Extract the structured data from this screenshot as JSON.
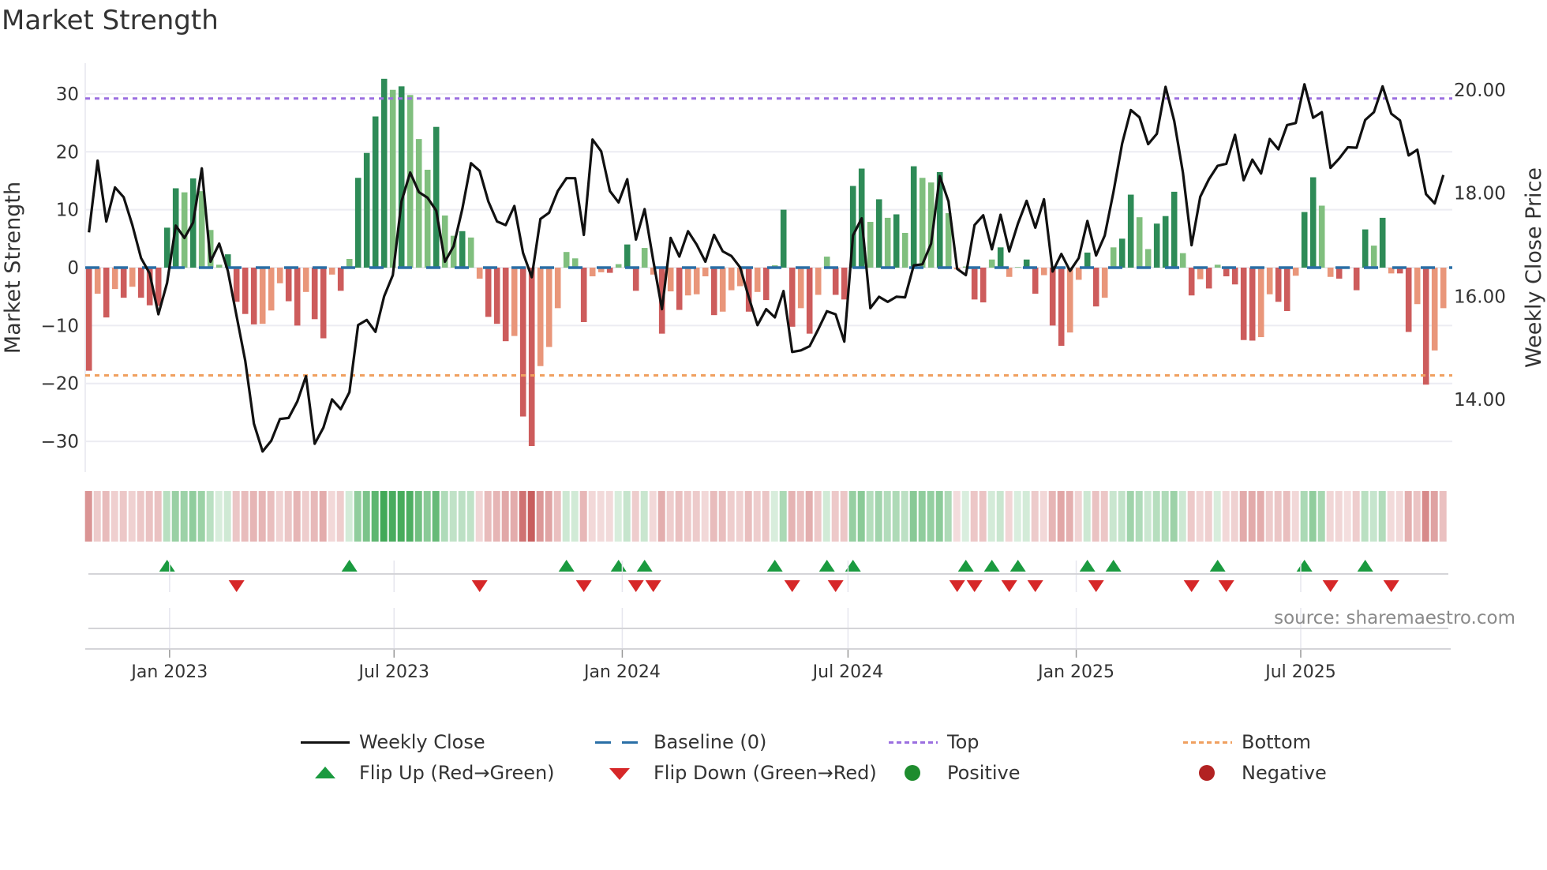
{
  "title": "Market Strength",
  "source": "source: sharemaestro.com",
  "chart_data": {
    "type": "bar+line",
    "title": "Market Strength",
    "ylabel": "Market Strength",
    "y2label": "Weekly Close Price",
    "ylim": [
      -35.3,
      35.3
    ],
    "y2lim": [
      12.59,
      20.52
    ],
    "yticks": [
      -30,
      -20,
      -10,
      0,
      10,
      20,
      30
    ],
    "ytick_labels": [
      "−30",
      "−20",
      "−10",
      "0",
      "10",
      "20",
      "30"
    ],
    "y2ticks": [
      14,
      16,
      18,
      20
    ],
    "y2tick_labels": [
      "14.00",
      "16.00",
      "18.00",
      "20.00"
    ],
    "start_date": "2022-10-28",
    "frequency": "weekly",
    "xticks": [
      {
        "date": "2023-01-01",
        "label": "Jan 2023"
      },
      {
        "date": "2023-07-01",
        "label": "Jul 2023"
      },
      {
        "date": "2024-01-01",
        "label": "Jan 2024"
      },
      {
        "date": "2024-07-01",
        "label": "Jul 2024"
      },
      {
        "date": "2025-01-01",
        "label": "Jan 2025"
      },
      {
        "date": "2025-07-01",
        "label": "Jul 2025"
      }
    ],
    "top_level": 29.2,
    "bottom_level": -18.6,
    "baseline": 0,
    "strength": [
      -17.8,
      -4.5,
      -8.6,
      -3.7,
      -5.2,
      -3.3,
      -5.2,
      -6.5,
      -6.6,
      6.9,
      13.7,
      13.0,
      15.4,
      13.2,
      6.5,
      0.5,
      2.3,
      -5.9,
      -8.0,
      -9.8,
      -9.7,
      -7.4,
      -2.7,
      -5.8,
      -10.0,
      -4.2,
      -8.9,
      -12.2,
      -1.2,
      -4.0,
      1.5,
      15.5,
      19.8,
      26.1,
      32.6,
      30.7,
      31.3,
      29.8,
      22.2,
      16.9,
      24.3,
      9.0,
      5.5,
      6.3,
      5.2,
      -1.9,
      -8.5,
      -9.7,
      -12.7,
      -11.8,
      -25.7,
      -30.8,
      -17.0,
      -13.7,
      -7.0,
      2.7,
      1.6,
      -9.4,
      -1.5,
      -0.8,
      -0.9,
      0.6,
      4.0,
      -4.0,
      3.4,
      -1.2,
      -11.4,
      -4.1,
      -7.3,
      -4.8,
      -4.6,
      -1.5,
      -8.2,
      -7.6,
      -3.9,
      -3.2,
      -7.6,
      -4.2,
      -5.6,
      0.4,
      10.0,
      -10.2,
      -7.0,
      -11.4,
      -4.7,
      1.9,
      -4.7,
      -5.5,
      14.1,
      17.1,
      7.9,
      11.8,
      8.6,
      9.2,
      6.0,
      17.5,
      15.5,
      14.7,
      16.5,
      9.4,
      -0.3,
      0.2,
      -5.5,
      -6.0,
      1.4,
      3.5,
      -1.6,
      0.1,
      1.4,
      -4.5,
      -1.3,
      -10.0,
      -13.5,
      -11.2,
      -2.1,
      2.6,
      -6.7,
      -5.2,
      3.5,
      5.0,
      12.6,
      8.7,
      3.2,
      7.6,
      8.9,
      13.1,
      2.5,
      -4.8,
      -2.0,
      -3.6,
      0.5,
      -1.5,
      -2.9,
      -12.5,
      -12.6,
      -12.0,
      -4.6,
      -5.9,
      -7.5,
      -1.4,
      9.6,
      15.6,
      10.7,
      -1.6,
      -1.9,
      -0.1,
      -3.9,
      6.6,
      3.8,
      8.6,
      -1.0,
      -1.0,
      -11.1,
      -6.3,
      -20.2,
      -14.3,
      -7.0
    ],
    "weekly_close": [
      17.24,
      18.63,
      17.45,
      18.11,
      17.92,
      17.38,
      16.74,
      16.44,
      15.65,
      16.26,
      17.37,
      17.13,
      17.43,
      18.48,
      16.67,
      17.02,
      16.49,
      15.62,
      14.75,
      13.53,
      12.99,
      13.2,
      13.62,
      13.64,
      13.96,
      14.45,
      13.14,
      13.45,
      14.0,
      13.81,
      14.14,
      15.44,
      15.54,
      15.31,
      16.0,
      16.41,
      17.84,
      18.4,
      18.02,
      17.91,
      17.66,
      16.67,
      16.97,
      17.69,
      18.58,
      18.43,
      17.84,
      17.45,
      17.38,
      17.75,
      16.84,
      16.37,
      17.5,
      17.62,
      18.04,
      18.29,
      18.29,
      17.19,
      19.04,
      18.81,
      18.04,
      17.82,
      18.27,
      17.1,
      17.69,
      16.69,
      15.75,
      17.13,
      16.77,
      17.26,
      17.0,
      16.67,
      17.19,
      16.87,
      16.78,
      16.56,
      15.98,
      15.44,
      15.75,
      15.59,
      16.1,
      14.92,
      14.95,
      15.03,
      15.36,
      15.71,
      15.65,
      15.12,
      17.18,
      17.51,
      15.77,
      15.99,
      15.89,
      15.99,
      15.98,
      16.6,
      16.62,
      17.02,
      18.33,
      17.84,
      16.53,
      16.41,
      17.38,
      17.57,
      16.91,
      17.58,
      16.87,
      17.41,
      17.85,
      17.33,
      17.88,
      16.48,
      16.82,
      16.49,
      16.74,
      17.46,
      16.79,
      17.18,
      18.02,
      18.96,
      19.61,
      19.47,
      18.95,
      19.15,
      20.06,
      19.4,
      18.4,
      16.99,
      17.93,
      18.27,
      18.53,
      18.57,
      19.13,
      18.25,
      18.65,
      18.38,
      19.05,
      18.85,
      19.32,
      19.36,
      20.11,
      19.46,
      19.57,
      18.49,
      18.67,
      18.89,
      18.88,
      19.42,
      19.57,
      20.07,
      19.54,
      19.41,
      18.73,
      18.84,
      17.98,
      17.8,
      18.35
    ],
    "flip_up_weeks": [
      10,
      31,
      56,
      62,
      65,
      80,
      86,
      89,
      102,
      105,
      108,
      116,
      119,
      131,
      141,
      148
    ],
    "flip_down_weeks": [
      18,
      46,
      58,
      64,
      66,
      82,
      87,
      101,
      103,
      107,
      110,
      117,
      128,
      132,
      144,
      151
    ],
    "colors": {
      "pos_strong": "#2e8b57",
      "pos_weak": "#80bf7e",
      "neg_strong": "#cd5c5c",
      "neg_weak": "#e9967a",
      "line": "#111111",
      "baseline": "#2a6fa6",
      "top": "#9b6fe0",
      "bottom": "#f0a060",
      "flip_up": "#1a9a3f",
      "flip_down": "#d62728",
      "positive": "#1e8c2e",
      "negative": "#b22222"
    },
    "legend": {
      "placement": "bottom",
      "items": {
        "weekly_close": "Weekly Close",
        "baseline": "Baseline (0)",
        "top": "Top",
        "bottom": "Bottom",
        "flip_up": "Flip Up (Red→Green)",
        "flip_down": "Flip Down (Green→Red)",
        "positive": "Positive",
        "negative": "Negative"
      }
    }
  }
}
